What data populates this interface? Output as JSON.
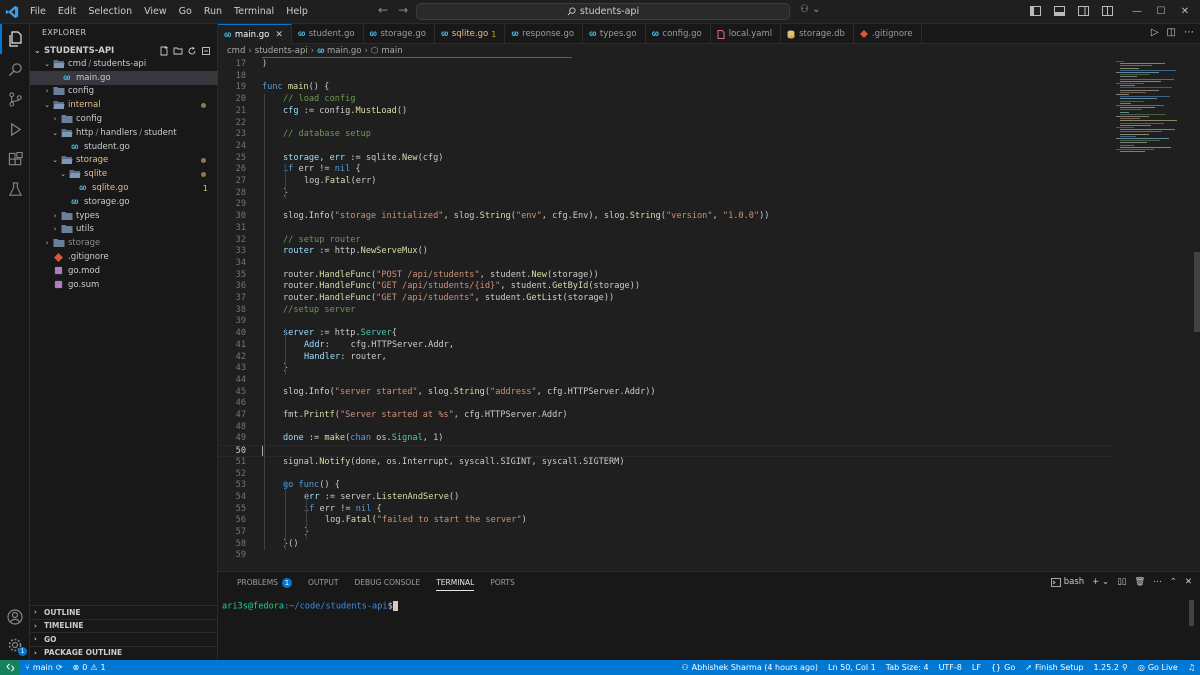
{
  "window": {
    "menu": [
      "File",
      "Edit",
      "Selection",
      "View",
      "Go",
      "Run",
      "Terminal",
      "Help"
    ],
    "search": "students-api"
  },
  "explorer": {
    "title": "EXPLORER",
    "root": "STUDENTS-API",
    "tree": [
      {
        "label": "cmd",
        "label2": "students-api",
        "depth": 1,
        "kind": "folder-open",
        "state": ""
      },
      {
        "label": "main.go",
        "depth": 2,
        "kind": "go",
        "state": "selected"
      },
      {
        "label": "config",
        "depth": 1,
        "kind": "folder-closed",
        "state": ""
      },
      {
        "label": "internal",
        "depth": 1,
        "kind": "folder-open",
        "state": "dot"
      },
      {
        "label": "config",
        "depth": 2,
        "kind": "folder-closed",
        "state": ""
      },
      {
        "label": "http",
        "label2": "handlers",
        "label3": "student",
        "depth": 2,
        "kind": "folder-open",
        "state": ""
      },
      {
        "label": "student.go",
        "depth": 3,
        "kind": "go",
        "state": ""
      },
      {
        "label": "storage",
        "depth": 2,
        "kind": "folder-open",
        "state": "dot"
      },
      {
        "label": "sqlite",
        "depth": 3,
        "kind": "folder-open",
        "state": "dot"
      },
      {
        "label": "sqlite.go",
        "depth": 4,
        "kind": "go",
        "state": "err",
        "badge": "1"
      },
      {
        "label": "storage.go",
        "depth": 3,
        "kind": "go",
        "state": ""
      },
      {
        "label": "types",
        "depth": 2,
        "kind": "folder-closed",
        "state": ""
      },
      {
        "label": "utils",
        "depth": 2,
        "kind": "folder-closed",
        "state": ""
      },
      {
        "label": "storage",
        "depth": 1,
        "kind": "folder-closed",
        "state": "dim"
      },
      {
        "label": ".gitignore",
        "depth": 1,
        "kind": "git",
        "state": ""
      },
      {
        "label": "go.mod",
        "depth": 1,
        "kind": "gomod",
        "state": ""
      },
      {
        "label": "go.sum",
        "depth": 1,
        "kind": "gomod",
        "state": ""
      }
    ],
    "sections": [
      "OUTLINE",
      "TIMELINE",
      "GO",
      "PACKAGE OUTLINE"
    ]
  },
  "tabs": [
    {
      "label": "main.go",
      "icon": "go",
      "active": true
    },
    {
      "label": "student.go",
      "icon": "go",
      "active": false
    },
    {
      "label": "storage.go",
      "icon": "go",
      "active": false
    },
    {
      "label": "sqlite.go",
      "icon": "go",
      "active": false,
      "badge": "1",
      "modified": true
    },
    {
      "label": "response.go",
      "icon": "go",
      "active": false
    },
    {
      "label": "types.go",
      "icon": "go",
      "active": false
    },
    {
      "label": "config.go",
      "icon": "go",
      "active": false
    },
    {
      "label": "local.yaml",
      "icon": "yaml",
      "active": false
    },
    {
      "label": "storage.db",
      "icon": "db",
      "active": false
    },
    {
      "label": ".gitignore",
      "icon": "git",
      "active": false
    }
  ],
  "breadcrumb": [
    "cmd",
    "students-api",
    "main.go",
    "main"
  ],
  "editor": {
    "current_line": 50,
    "lines": [
      {
        "n": 17,
        "indent": 0,
        "t": [
          [
            ")",
            "p"
          ]
        ]
      },
      {
        "n": 18,
        "indent": 0,
        "t": []
      },
      {
        "n": 19,
        "indent": 0,
        "t": [
          [
            "func ",
            "kw"
          ],
          [
            "main",
            "fn"
          ],
          [
            "() {",
            "p"
          ]
        ]
      },
      {
        "n": 20,
        "indent": 1,
        "t": [
          [
            "// load config",
            "cm"
          ]
        ]
      },
      {
        "n": 21,
        "indent": 1,
        "t": [
          [
            "cfg",
            "va"
          ],
          [
            " := ",
            "p"
          ],
          [
            "config",
            "p"
          ],
          [
            ".",
            "p"
          ],
          [
            "MustLoad",
            "fn"
          ],
          [
            "()",
            "p"
          ]
        ]
      },
      {
        "n": 22,
        "indent": 0,
        "t": []
      },
      {
        "n": 23,
        "indent": 1,
        "t": [
          [
            "// database setup",
            "cm"
          ]
        ]
      },
      {
        "n": 24,
        "indent": 0,
        "t": []
      },
      {
        "n": 25,
        "indent": 1,
        "t": [
          [
            "storage",
            "va"
          ],
          [
            ", ",
            "p"
          ],
          [
            "err",
            "va"
          ],
          [
            " := ",
            "p"
          ],
          [
            "sqlite",
            "p"
          ],
          [
            ".",
            "p"
          ],
          [
            "New",
            "fn"
          ],
          [
            "(cfg)",
            "p"
          ]
        ]
      },
      {
        "n": 26,
        "indent": 1,
        "t": [
          [
            "if ",
            "kw"
          ],
          [
            "err != ",
            "p"
          ],
          [
            "nil",
            "kw"
          ],
          [
            " {",
            "p"
          ]
        ]
      },
      {
        "n": 27,
        "indent": 2,
        "t": [
          [
            "log",
            "p"
          ],
          [
            ".",
            "p"
          ],
          [
            "Fatal",
            "fn"
          ],
          [
            "(err)",
            "p"
          ]
        ]
      },
      {
        "n": 28,
        "indent": 1,
        "t": [
          [
            "}",
            "p"
          ]
        ]
      },
      {
        "n": 29,
        "indent": 0,
        "t": []
      },
      {
        "n": 30,
        "indent": 1,
        "t": [
          [
            "slog",
            "p"
          ],
          [
            ".",
            "p"
          ],
          [
            "Info",
            "fn"
          ],
          [
            "(",
            "p"
          ],
          [
            "\"storage initialized\"",
            "str"
          ],
          [
            ", slog.",
            "p"
          ],
          [
            "String",
            "fn"
          ],
          [
            "(",
            "p"
          ],
          [
            "\"env\"",
            "str"
          ],
          [
            ", cfg.Env), slog.",
            "p"
          ],
          [
            "String",
            "fn"
          ],
          [
            "(",
            "p"
          ],
          [
            "\"version\"",
            "str"
          ],
          [
            ", ",
            "p"
          ],
          [
            "\"1.0.0\"",
            "str"
          ],
          [
            "))",
            "p"
          ]
        ]
      },
      {
        "n": 31,
        "indent": 0,
        "t": []
      },
      {
        "n": 32,
        "indent": 1,
        "t": [
          [
            "// setup router",
            "cm"
          ]
        ]
      },
      {
        "n": 33,
        "indent": 1,
        "t": [
          [
            "router",
            "va"
          ],
          [
            " := ",
            "p"
          ],
          [
            "http",
            "p"
          ],
          [
            ".",
            "p"
          ],
          [
            "NewServeMux",
            "fn"
          ],
          [
            "()",
            "p"
          ]
        ]
      },
      {
        "n": 34,
        "indent": 0,
        "t": []
      },
      {
        "n": 35,
        "indent": 1,
        "t": [
          [
            "router",
            "p"
          ],
          [
            ".",
            "p"
          ],
          [
            "HandleFunc",
            "fn"
          ],
          [
            "(",
            "p"
          ],
          [
            "\"POST /api/students\"",
            "str"
          ],
          [
            ", student.",
            "p"
          ],
          [
            "New",
            "fn"
          ],
          [
            "(storage))",
            "p"
          ]
        ]
      },
      {
        "n": 36,
        "indent": 1,
        "t": [
          [
            "router",
            "p"
          ],
          [
            ".",
            "p"
          ],
          [
            "HandleFunc",
            "fn"
          ],
          [
            "(",
            "p"
          ],
          [
            "\"GET /api/students/{id}\"",
            "str"
          ],
          [
            ", student.",
            "p"
          ],
          [
            "GetById",
            "fn"
          ],
          [
            "(storage))",
            "p"
          ]
        ]
      },
      {
        "n": 37,
        "indent": 1,
        "t": [
          [
            "router",
            "p"
          ],
          [
            ".",
            "p"
          ],
          [
            "HandleFunc",
            "fn"
          ],
          [
            "(",
            "p"
          ],
          [
            "\"GET /api/students\"",
            "str"
          ],
          [
            ", student.",
            "p"
          ],
          [
            "GetList",
            "fn"
          ],
          [
            "(storage))",
            "p"
          ]
        ]
      },
      {
        "n": 38,
        "indent": 1,
        "t": [
          [
            "//setup server",
            "cm"
          ]
        ]
      },
      {
        "n": 39,
        "indent": 0,
        "t": []
      },
      {
        "n": 40,
        "indent": 1,
        "t": [
          [
            "server",
            "va"
          ],
          [
            " := ",
            "p"
          ],
          [
            "http",
            "p"
          ],
          [
            ".",
            "p"
          ],
          [
            "Server",
            "ty"
          ],
          [
            "{",
            "p"
          ]
        ]
      },
      {
        "n": 41,
        "indent": 2,
        "t": [
          [
            "Addr",
            "va"
          ],
          [
            ":    cfg.HTTPServer.Addr,",
            "p"
          ]
        ]
      },
      {
        "n": 42,
        "indent": 2,
        "t": [
          [
            "Handler",
            "va"
          ],
          [
            ": router,",
            "p"
          ]
        ]
      },
      {
        "n": 43,
        "indent": 1,
        "t": [
          [
            "}",
            "p"
          ]
        ]
      },
      {
        "n": 44,
        "indent": 0,
        "t": []
      },
      {
        "n": 45,
        "indent": 1,
        "t": [
          [
            "slog",
            "p"
          ],
          [
            ".",
            "p"
          ],
          [
            "Info",
            "fn"
          ],
          [
            "(",
            "p"
          ],
          [
            "\"server started\"",
            "str"
          ],
          [
            ", slog.",
            "p"
          ],
          [
            "String",
            "fn"
          ],
          [
            "(",
            "p"
          ],
          [
            "\"address\"",
            "str"
          ],
          [
            ", cfg.HTTPServer.Addr))",
            "p"
          ]
        ]
      },
      {
        "n": 46,
        "indent": 0,
        "t": []
      },
      {
        "n": 47,
        "indent": 1,
        "t": [
          [
            "fmt",
            "p"
          ],
          [
            ".",
            "p"
          ],
          [
            "Printf",
            "fn"
          ],
          [
            "(",
            "p"
          ],
          [
            "\"Server started at %s\"",
            "str"
          ],
          [
            ", cfg.HTTPServer.Addr)",
            "p"
          ]
        ]
      },
      {
        "n": 48,
        "indent": 0,
        "t": []
      },
      {
        "n": 49,
        "indent": 1,
        "t": [
          [
            "done",
            "va"
          ],
          [
            " := ",
            "p"
          ],
          [
            "make",
            "fn"
          ],
          [
            "(",
            "p"
          ],
          [
            "chan ",
            "kw"
          ],
          [
            "os.",
            "p"
          ],
          [
            "Signal",
            "ty"
          ],
          [
            ", ",
            "p"
          ],
          [
            "1",
            "num"
          ],
          [
            ")",
            "p"
          ]
        ]
      },
      {
        "n": 50,
        "indent": 0,
        "t": []
      },
      {
        "n": 51,
        "indent": 1,
        "t": [
          [
            "signal",
            "p"
          ],
          [
            ".",
            "p"
          ],
          [
            "Notify",
            "fn"
          ],
          [
            "(done, os.Interrupt, syscall.SIGINT, syscall.SIGTERM)",
            "p"
          ]
        ]
      },
      {
        "n": 52,
        "indent": 0,
        "t": []
      },
      {
        "n": 53,
        "indent": 1,
        "t": [
          [
            "go ",
            "kw"
          ],
          [
            "func",
            "kw"
          ],
          [
            "() {",
            "p"
          ]
        ]
      },
      {
        "n": 54,
        "indent": 2,
        "t": [
          [
            "err",
            "va"
          ],
          [
            " := ",
            "p"
          ],
          [
            "server",
            "p"
          ],
          [
            ".",
            "p"
          ],
          [
            "ListenAndServe",
            "fn"
          ],
          [
            "()",
            "p"
          ]
        ]
      },
      {
        "n": 55,
        "indent": 2,
        "t": [
          [
            "if ",
            "kw"
          ],
          [
            "err != ",
            "p"
          ],
          [
            "nil",
            "kw"
          ],
          [
            " {",
            "p"
          ]
        ]
      },
      {
        "n": 56,
        "indent": 3,
        "t": [
          [
            "log",
            "p"
          ],
          [
            ".",
            "p"
          ],
          [
            "Fatal",
            "fn"
          ],
          [
            "(",
            "p"
          ],
          [
            "\"failed to start the server\"",
            "str"
          ],
          [
            ")",
            "p"
          ]
        ]
      },
      {
        "n": 57,
        "indent": 2,
        "t": [
          [
            "}",
            "p"
          ]
        ]
      },
      {
        "n": 58,
        "indent": 1,
        "t": [
          [
            "}()",
            "p"
          ]
        ]
      },
      {
        "n": 59,
        "indent": 0,
        "t": []
      }
    ]
  },
  "panel": {
    "tabs": [
      "PROBLEMS",
      "OUTPUT",
      "DEBUG CONSOLE",
      "TERMINAL",
      "PORTS"
    ],
    "problems_count": "1",
    "active_tab": "TERMINAL",
    "shell": "bash",
    "prompt_user": "ari3s@fedora",
    "prompt_path": ":~/code/students-api",
    "prompt_symbol": "$"
  },
  "status": {
    "branch": "main",
    "errors": "0",
    "warnings": "1",
    "blame": "Abhishek Sharma (4 hours ago)",
    "position": "Ln 50, Col 1",
    "tab_size": "Tab Size: 4",
    "encoding": "UTF-8",
    "eol": "LF",
    "language": "Go",
    "finish_setup": "Finish Setup",
    "go_version": "1.25.2",
    "go_live": "Go Live",
    "notifications_count": "1"
  },
  "colors": {
    "accent": "#0078d4",
    "status_bar": "#0078d4",
    "remote": "#16825d",
    "modified": "#e2c08d",
    "go_icon": "#4fc1e9"
  }
}
